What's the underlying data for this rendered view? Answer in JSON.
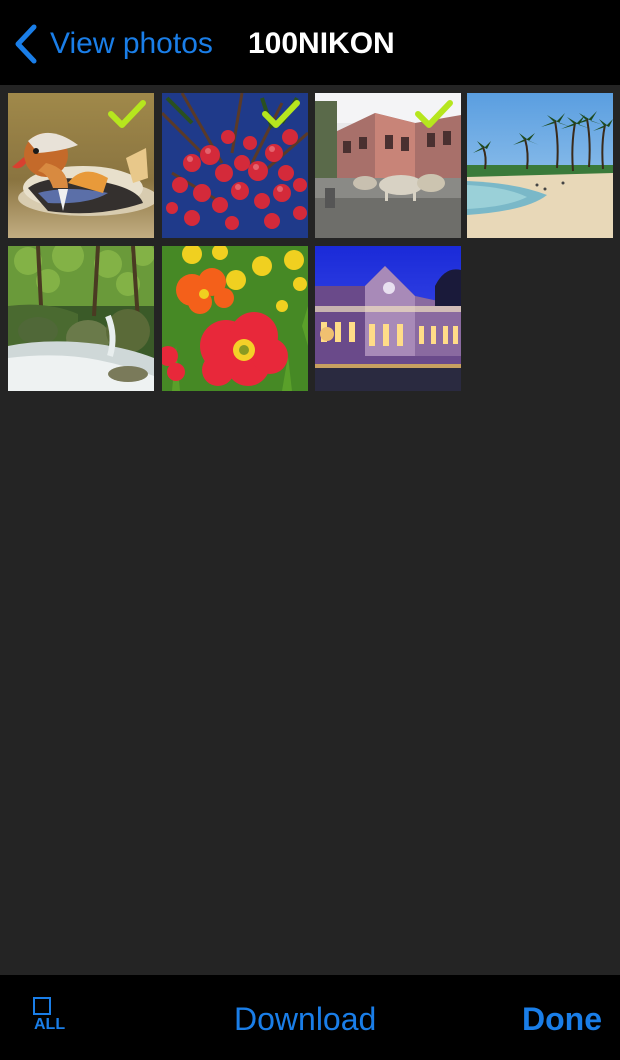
{
  "nav": {
    "back_label": "View photos",
    "title": "100NIKON"
  },
  "photos": [
    {
      "subject": "mandarin-duck",
      "selected": true
    },
    {
      "subject": "red-berries",
      "selected": true
    },
    {
      "subject": "street-cattle",
      "selected": true
    },
    {
      "subject": "palm-beach",
      "selected": false
    },
    {
      "subject": "forest-stream",
      "selected": false
    },
    {
      "subject": "poppy-flowers",
      "selected": false
    },
    {
      "subject": "lit-building-dusk",
      "selected": false
    }
  ],
  "toolbar": {
    "select_all_label": "ALL",
    "download_label": "Download",
    "done_label": "Done"
  },
  "colors": {
    "accent": "#1a7ee8",
    "checkmark": "#b6e61e",
    "bar_background": "#000000",
    "grid_background": "#242424"
  }
}
